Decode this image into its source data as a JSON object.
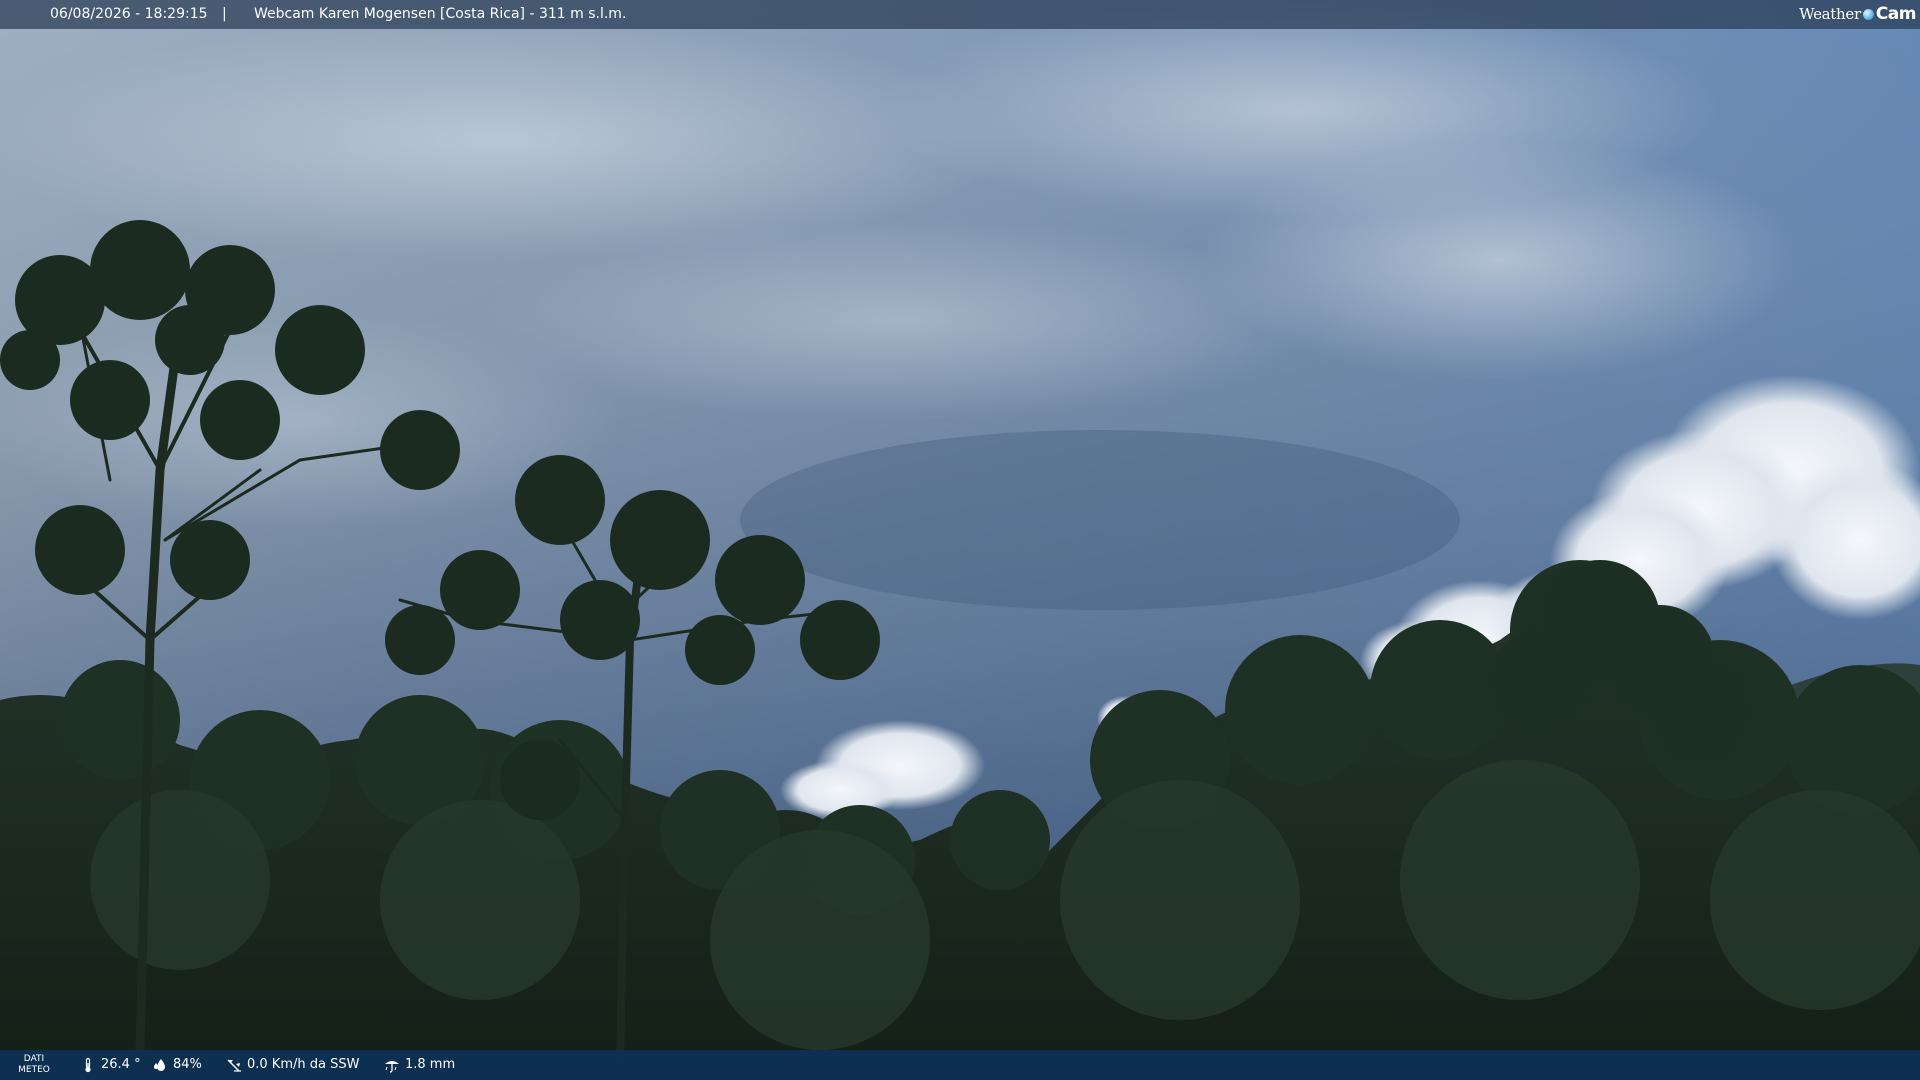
{
  "overlay": {
    "timestamp": "06/08/2026 - 18:29:15",
    "separator": "|",
    "camera_title": "Webcam Karen Mogensen [Costa Rica]  - 311 m s.l.m.",
    "logo": {
      "weather": "Weather",
      "cam": "Cam"
    }
  },
  "weather_data": {
    "label_line1": "DATI",
    "label_line2": "METEO",
    "temperature": "26.4 °",
    "humidity": "84%",
    "wind": "0.0 Km/h da SSW",
    "rain": "1.8 mm"
  },
  "icons": {
    "temperature": "thermometer-icon",
    "humidity": "droplets-icon",
    "wind": "wind-vane-icon",
    "rain": "rain-gauge-icon"
  },
  "colors": {
    "top_bar": "#283c55",
    "bottom_bar": "#0c325a",
    "sky_top": "#a8b8c8",
    "sky_bottom": "#2f4a6c",
    "foliage": "#1a2a1c"
  }
}
